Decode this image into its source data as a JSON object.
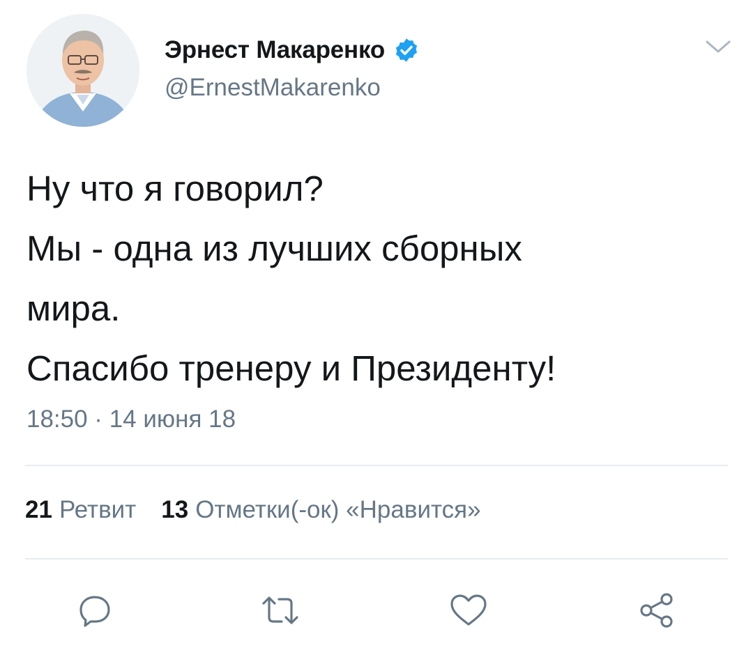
{
  "author": {
    "name": "Эрнест Макаренко",
    "handle": "@ErnestMakarenko",
    "verified": true,
    "verified_color": "#1da1f2"
  },
  "tweet": {
    "lines": [
      "Ну что я говорил?",
      "Мы - одна из лучших сборных",
      "мира.",
      "Спасибо тренеру и Президенту!"
    ],
    "timestamp": "18:50 · 14 июня 18"
  },
  "stats": {
    "retweets": {
      "count": "21",
      "label": "Ретвит"
    },
    "likes": {
      "count": "13",
      "label": "Отметки(-ок) «Нравится»"
    }
  },
  "actions": {
    "reply_icon": "reply-icon",
    "retweet_icon": "retweet-icon",
    "like_icon": "heart-icon",
    "share_icon": "share-icon"
  },
  "colors": {
    "text_primary": "#14171a",
    "text_secondary": "#657786",
    "divider": "#e6ecf0",
    "icon": "#657786"
  }
}
